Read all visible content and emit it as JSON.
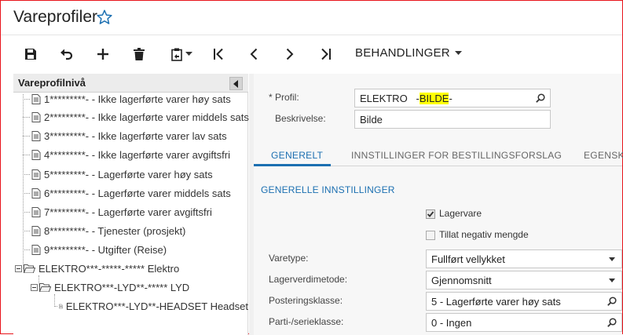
{
  "header": {
    "title": "Vareprofiler",
    "favorite_icon": "star-icon"
  },
  "toolbar": {
    "buttons": [
      {
        "name": "save-button",
        "icon": "save-icon"
      },
      {
        "name": "undo-button",
        "icon": "undo-icon"
      },
      {
        "name": "add-button",
        "icon": "plus-icon"
      },
      {
        "name": "delete-button",
        "icon": "trash-icon"
      },
      {
        "name": "clipboard-button",
        "icon": "clipboard-icon"
      },
      {
        "name": "first-button",
        "icon": "first-icon"
      },
      {
        "name": "prev-button",
        "icon": "prev-icon"
      },
      {
        "name": "next-button",
        "icon": "next-icon"
      },
      {
        "name": "last-button",
        "icon": "last-icon"
      }
    ],
    "actions_label": "BEHANDLINGER"
  },
  "tree": {
    "header": "Vareprofilnivå",
    "items": [
      {
        "label": "1*********- - Ikke lagerførte varer høy sats"
      },
      {
        "label": "2*********- - Ikke lagerførte varer middels sats"
      },
      {
        "label": "3*********- - Ikke lagerførte varer lav sats"
      },
      {
        "label": "4*********- - Ikke lagerførte varer avgiftsfri"
      },
      {
        "label": "5*********- - Lagerførte varer høy sats"
      },
      {
        "label": "6*********- - Lagerførte varer middels sats"
      },
      {
        "label": "7*********- - Lagerførte varer avgiftsfri"
      },
      {
        "label": "8*********- - Tjenester (prosjekt)"
      },
      {
        "label": "9*********- - Utgifter (Reise)"
      },
      {
        "label": "ELEKTRO***-*****-***** Elektro"
      },
      {
        "label": "ELEKTRO***-LYD**-***** LYD"
      },
      {
        "label": "ELEKTRO***-LYD**-HEADSET Headset"
      }
    ]
  },
  "form": {
    "profil_label": "* Profil:",
    "profil_value_prefix": "ELEKTRO   -",
    "profil_value_highlight": "BILDE",
    "profil_value_suffix": "-",
    "beskrivelse_label": "Beskrivelse:",
    "beskrivelse_value": "Bilde",
    "highlight_color": "#ffff00"
  },
  "tabs": [
    {
      "label": "GENERELT",
      "active": true
    },
    {
      "label": "INNSTILLINGER FOR BESTILLINGSFORSLAG",
      "active": false
    },
    {
      "label": "EGENSK",
      "active": false
    }
  ],
  "general": {
    "section_title": "GENERELLE INNSTILLINGER",
    "lagervare_label": "Lagervare",
    "lagervare_checked": true,
    "negativ_label": "Tillat negativ mengde",
    "negativ_checked": false,
    "varetype_label": "Varetype:",
    "varetype_value": "Fullført vellykket",
    "lagerverdimetode_label": "Lagerverdimetode:",
    "lagerverdimetode_value": "Gjennomsnitt",
    "posteringsklasse_label": "Posteringsklasse:",
    "posteringsklasse_value": "5 - Lagerførte varer høy sats",
    "parti_label": "Parti-/serieklasse:",
    "parti_value": "0 - Ingen"
  },
  "colors": {
    "accent": "#1b6fb1",
    "window_border": "#e8141b"
  }
}
